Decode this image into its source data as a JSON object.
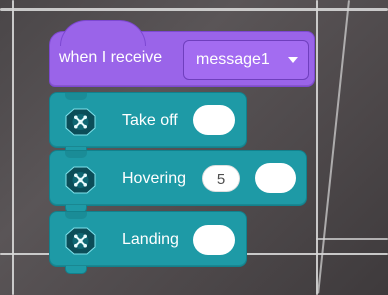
{
  "event_block": {
    "label": "when I receive",
    "selected_message": "message1",
    "color": "#9a64e9"
  },
  "commands": [
    {
      "label": "Take off",
      "icon": "drone-icon",
      "input_value": ""
    },
    {
      "label": "Hovering",
      "icon": "drone-icon",
      "value": "5",
      "input_value": ""
    },
    {
      "label": "Landing",
      "icon": "drone-icon",
      "input_value": ""
    }
  ],
  "colors": {
    "command_block": "#1e9aa6",
    "text": "#ffffff",
    "input": "#ffffff"
  }
}
